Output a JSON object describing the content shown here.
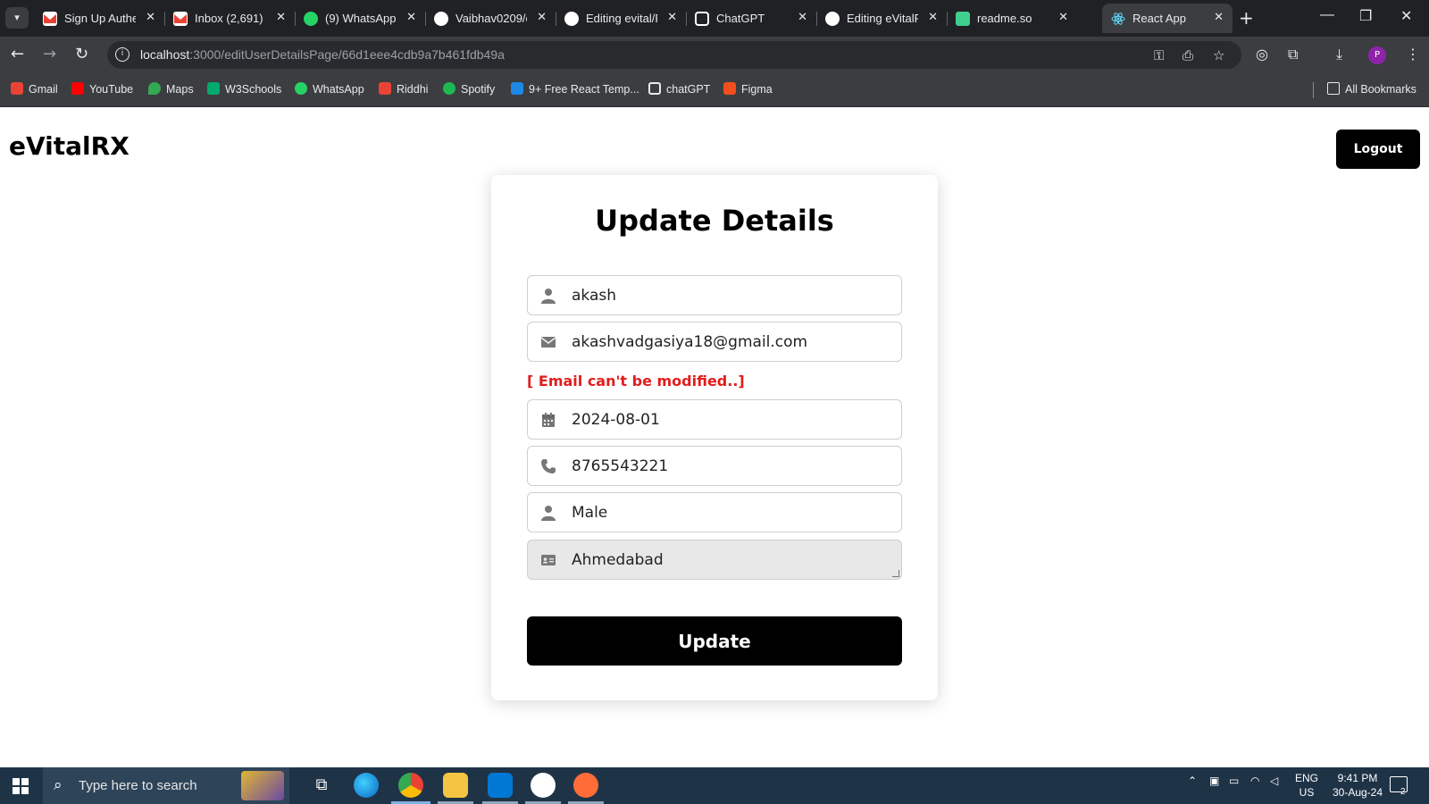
{
  "browser": {
    "tabs": [
      {
        "title": "Sign Up Authe",
        "icon": "gmail-icon",
        "color": "#ea4335"
      },
      {
        "title": "Inbox (2,691) -",
        "icon": "gmail-icon",
        "color": "#ea4335"
      },
      {
        "title": "(9) WhatsApp",
        "icon": "whatsapp-icon",
        "color": "#25d366"
      },
      {
        "title": "Vaibhav0209/e",
        "icon": "github-icon",
        "color": "#ffffff"
      },
      {
        "title": "Editing evital/F",
        "icon": "github-icon",
        "color": "#ffffff"
      },
      {
        "title": "ChatGPT",
        "icon": "chatgpt-icon",
        "color": "#ffffff"
      },
      {
        "title": "Editing eVitalR",
        "icon": "github-icon",
        "color": "#ffffff"
      },
      {
        "title": "readme.so",
        "icon": "readme-icon",
        "color": "#3ecf8e"
      },
      {
        "title": "React App",
        "icon": "react-icon",
        "color": "#61dafb",
        "active": true
      }
    ],
    "new_tab": "+",
    "url_host": "localhost",
    "url_path": ":3000/editUserDetailsPage/66d1eee4cdb9a7b461fdb49a",
    "profile_initial": "P",
    "bookmarks": [
      {
        "label": "Gmail",
        "color": "#ea4335"
      },
      {
        "label": "YouTube",
        "color": "#ff0000"
      },
      {
        "label": "Maps",
        "color": "#34a853"
      },
      {
        "label": "W3Schools",
        "color": "#04aa6d"
      },
      {
        "label": "WhatsApp",
        "color": "#25d366"
      },
      {
        "label": "Riddhi",
        "color": "#ea4335"
      },
      {
        "label": "Spotify",
        "color": "#1db954"
      },
      {
        "label": "9+ Free React Temp...",
        "color": "#1e88e5"
      },
      {
        "label": "chatGPT",
        "color": "#e8eaed"
      },
      {
        "label": "Figma",
        "color": "#f24e1e"
      }
    ],
    "all_bookmarks": "All Bookmarks"
  },
  "app": {
    "brand": "eVitalRX",
    "logout_label": "Logout",
    "form": {
      "title": "Update Details",
      "name": "akash",
      "email": "akashvadgasiya18@gmail.com",
      "email_note": "[ Email can't be modified..]",
      "dob": "2024-08-01",
      "phone": "8765543221",
      "gender": "Male",
      "address": "Ahmedabad",
      "submit_label": "Update"
    }
  },
  "taskbar": {
    "search_placeholder": "Type here to search",
    "lang_top": "ENG",
    "lang_bottom": "US",
    "time": "9:41 PM",
    "date": "30-Aug-24",
    "notification_count": "2"
  },
  "colors": {
    "accent": "#000000",
    "error": "#e11d1d",
    "taskbar": "#1f3347"
  }
}
